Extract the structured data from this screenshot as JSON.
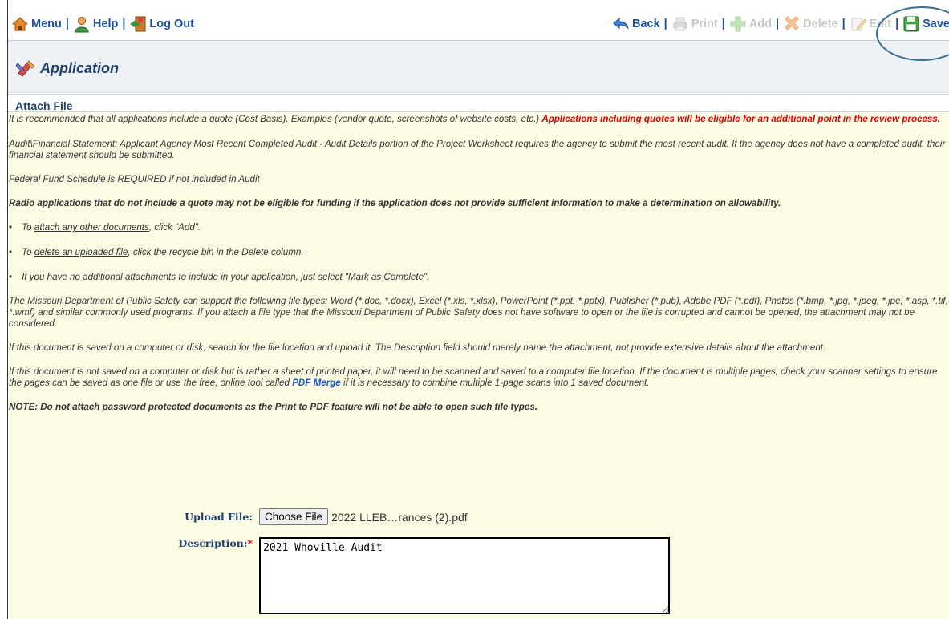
{
  "toolbar": {
    "menu": "Menu",
    "help": "Help",
    "logout": "Log Out",
    "back": "Back",
    "print": "Print",
    "add": "Add",
    "delete": "Delete",
    "edit": "Edit",
    "save": "Save",
    "separator": "|"
  },
  "page": {
    "title": "Application"
  },
  "section": {
    "title": "Attach File",
    "intro": "It is recommended that all applications include a quote (Cost Basis). Examples (vendor quote, screenshots of website costs, etc.) ",
    "intro_red": "Applications including quotes will be eligible for an additional point in the review process.",
    "audit": "Audit\\Financial Statement: Applicant Agency Most Recent Completed Audit - Audit Details portion of the Project Worksheet requires the agency to submit the most recent audit. If the agency does not have a completed audit, their financial statement should be submitted.",
    "federal": "Federal Fund Schedule is REQUIRED if not included in Audit",
    "radio": "Radio applications that do not include a quote may not be eligible for funding if the application does not provide sufficient information to make a determination on allowability.",
    "bullet1_pre": "To ",
    "bullet1_link": "attach any other documents",
    "bullet1_post": ", click \"Add\".",
    "bullet2_pre": "To ",
    "bullet2_link": "delete an uploaded file",
    "bullet2_post": ", click the recycle bin in the Delete column.",
    "bullet3": "If you have no additional attachments to include in your application, just select \"Mark as Complete\".",
    "filetypes": "The Missouri Department of Public Safety can support the following file types: Word (*.doc, *.docx), Excel (*.xls, *.xlsx), PowerPoint (*.ppt, *.pptx), Publisher (*.pub), Adobe PDF (*.pdf), Photos (*.bmp, *.jpg, *.jpeg, *.jpe, *.asp, *.tif, *.wmf) and similar commonly used programs. If you attach a file type that the Missouri Department of Public Safety does not have software to open or the file is corrupted and cannot be opened, the attachment may not be considered.",
    "saved": "If this document is saved on a computer or disk, search for the file location and upload it. The Description field should merely name the attachment, not provide extensive details about the attachment.",
    "scan_pre": "If this document is not saved on a computer or disk but is rather a sheet of printed paper, it will need to be scanned and saved to a computer file location. If the document is multiple pages, check your scanner settings to ensure the pages can be saved as one file or use the free, online tool called ",
    "scan_link": "PDF Merge",
    "scan_post": " if it is necessary to combine multiple 1-page scans into 1 saved document.",
    "note": "NOTE: Do not attach password protected documents as the Print to PDF feature will not be able to open such file types."
  },
  "form": {
    "upload_label": "Upload File:",
    "choose_button": "Choose File",
    "file_name": "2022 LLEB…rances (2).pdf",
    "description_label": "Description:",
    "required_mark": "*",
    "description_value": "2021 Whoville Audit"
  }
}
